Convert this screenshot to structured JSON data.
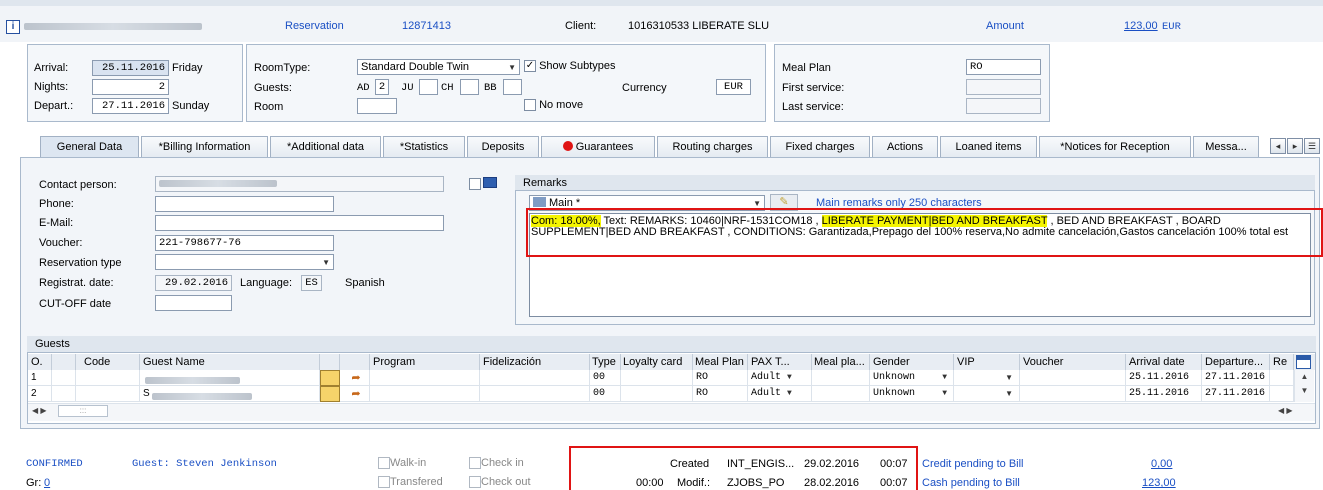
{
  "header": {
    "name_blurred": "NEO PRESENTS Nik ...",
    "reservation_label": "Reservation",
    "reservation_no": "12871413",
    "client_label": "Client:",
    "client_value": "1016310533  LIBERATE SLU",
    "amount_label": "Amount",
    "amount_value": "123,00",
    "amount_currency": "EUR"
  },
  "stay": {
    "arrival_label": "Arrival:",
    "arrival_date": "25.11.2016",
    "arrival_day": "Friday",
    "nights_label": "Nights:",
    "nights": "2",
    "depart_label": "Depart.:",
    "depart_date": "27.11.2016",
    "depart_day": "Sunday"
  },
  "room": {
    "roomtype_label": "RoomType:",
    "roomtype_value": "Standard Double Twin",
    "show_subtypes": "Show Subtypes",
    "guests_label": "Guests:",
    "ad_label": "AD",
    "ad_value": "2",
    "ju_label": "JU",
    "ch_label": "CH",
    "bb_label": "BB",
    "currency_label": "Currency",
    "currency_value": "EUR",
    "room_label": "Room",
    "no_move": "No move"
  },
  "meal": {
    "mealplan_label": "Meal Plan",
    "mealplan_value": "RO",
    "first_label": "First service:",
    "last_label": "Last service:"
  },
  "tabs": [
    "General Data",
    "*Billing Information",
    "*Additional data",
    "*Statistics",
    "Deposits",
    "Guarantees",
    "Routing charges",
    "Fixed charges",
    "Actions",
    "Loaned items",
    "*Notices for Reception",
    "Messa..."
  ],
  "general": {
    "contact_label": "Contact person:",
    "contact_value": "STEVEN JENKINSON",
    "phone_label": "Phone:",
    "email_label": "E-Mail:",
    "voucher_label": "Voucher:",
    "voucher_value": "221-798677-76",
    "restype_label": "Reservation type",
    "registr_label": "Registrat. date:",
    "registr_value": "29.02.2016",
    "language_label": "Language:",
    "language_code": "ES",
    "language_name": "Spanish",
    "cutoff_label": "CUT-OFF date"
  },
  "remarks": {
    "title": "Remarks",
    "select_value": "Main *",
    "hint": "Main remarks only 250 characters",
    "text_hl1": "Com: 18.00%,",
    "text_1": " Text:  REMARKS: 10460|NRF-1531COM18 , ",
    "text_hl2": "LIBERATE PAYMENT|BED AND BREAKFAST",
    "text_2": " , BED AND BREAKFAST , BOARD SUPPLEMENT|BED AND BREAKFAST , CONDITIONS: Garantizada,Prepago del 100% reserva,No admite cancelación,Gastos cancelación 100% total est"
  },
  "guests": {
    "title": "Guests",
    "columns": [
      "O.",
      "Code",
      "Guest Name",
      "",
      "",
      "Program",
      "Fidelización",
      "Type",
      "Loyalty card",
      "Meal Plan",
      "PAX T...",
      "Meal pla...",
      "Gender",
      "VIP",
      "Voucher",
      "Arrival date",
      "Departure...",
      "Re"
    ],
    "rows": [
      {
        "o": "1",
        "name": "Steven Jenkinson",
        "type": "00",
        "meal": "RO",
        "pax": "Adult",
        "gender": "Unknown",
        "arrival": "25.11.2016",
        "departure": "27.11.2016"
      },
      {
        "o": "2",
        "name": "S...",
        "type": "00",
        "meal": "RO",
        "pax": "Adult",
        "gender": "Unknown",
        "arrival": "25.11.2016",
        "departure": "27.11.2016"
      }
    ]
  },
  "footer": {
    "status": "CONFIRMED",
    "guest": "Guest: Steven Jenkinson",
    "gr_label": "Gr:",
    "gr_value": "0",
    "walkin": "Walk-in",
    "checkin": "Check in",
    "transfered": "Transfered",
    "checkout": "Check out",
    "created_label": "Created",
    "created_user": "INT_ENGIS...",
    "created_date": "29.02.2016",
    "created_time": "00:07",
    "modif_time0": "00:00",
    "modif_label": "Modif.:",
    "modif_user": "ZJOBS_PO",
    "modif_date": "28.02.2016",
    "modif_time": "00:07",
    "credit_label": "Credit pending to Bill",
    "credit_value": "0,00",
    "cash_label": "Cash pending to Bill",
    "cash_value": "123,00"
  },
  "colors": {
    "highlight": "#f5f500",
    "redbox": "#e01414",
    "link": "#1a4fc4"
  }
}
